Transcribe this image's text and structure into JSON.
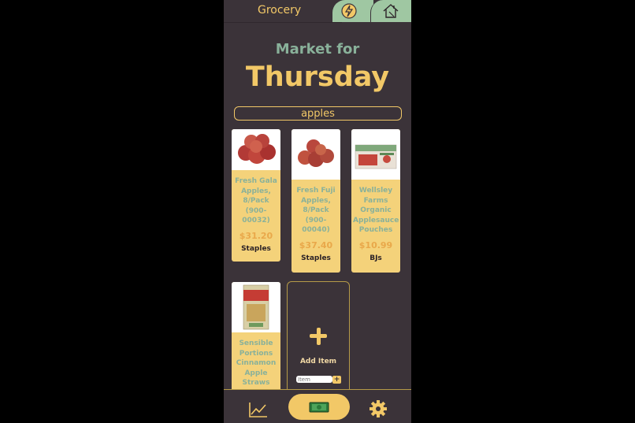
{
  "tabs": {
    "grocery_label": "Grocery",
    "energy_icon": "lightning-icon",
    "home_icon": "home-icon"
  },
  "header": {
    "subtitle": "Market for",
    "title": "Thursday"
  },
  "search": {
    "value": "apples"
  },
  "products": [
    {
      "name": "Fresh Gala Apples, 8/Pack (900-00032)",
      "price": "$31.20",
      "store": "Staples"
    },
    {
      "name": "Fresh Fuji Apples, 8/Pack (900-00040)",
      "price": "$37.40",
      "store": "Staples"
    },
    {
      "name": "Wellsley Farms Organic Applesauce Pouches",
      "price": "$10.99",
      "store": "BJs"
    },
    {
      "name": "Sensible Portions Cinnamon Apple Straws",
      "price": "",
      "store": ""
    }
  ],
  "add_item": {
    "label": "Add Item",
    "input_placeholder": "Item",
    "button_label": "+"
  },
  "bottom_nav": {
    "chart_icon": "chart-icon",
    "money_icon": "money-icon",
    "settings_icon": "gear-icon"
  },
  "colors": {
    "background": "#3b3339",
    "accent": "#f2c867",
    "green": "#9fc7a2",
    "text_green": "#89b19a"
  }
}
